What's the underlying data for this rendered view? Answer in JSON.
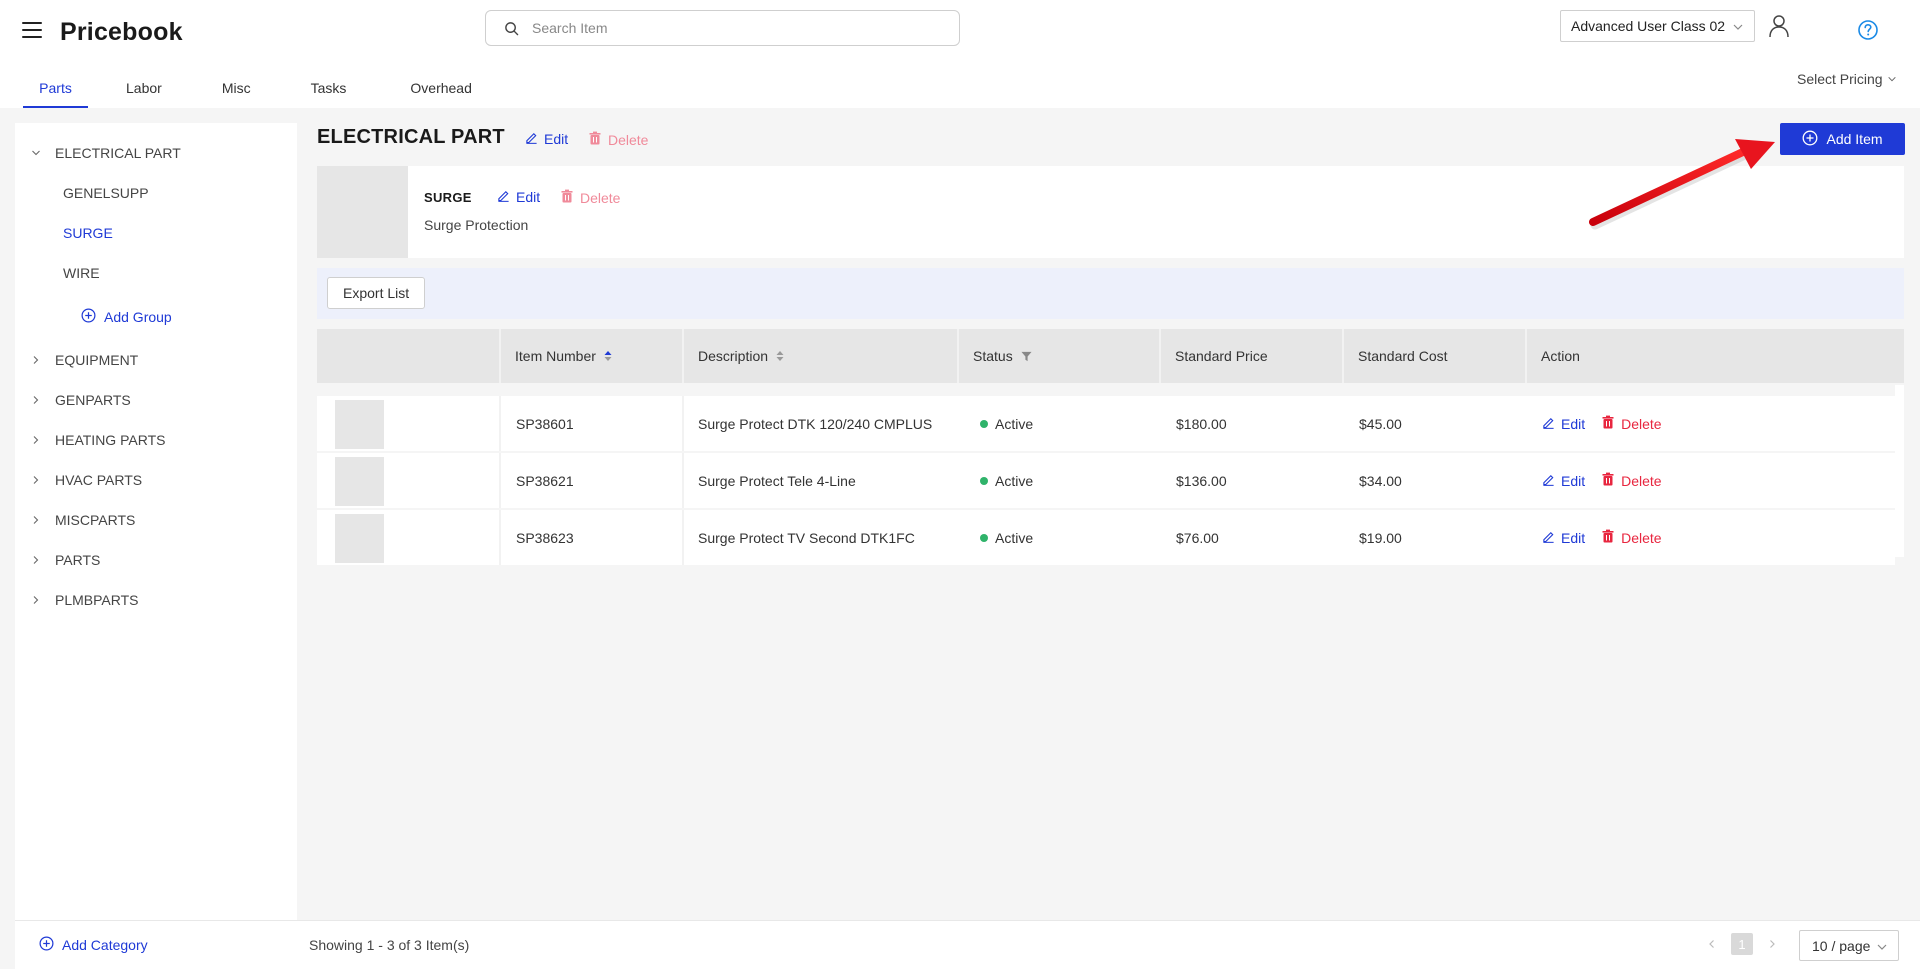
{
  "header": {
    "title": "Pricebook",
    "search_placeholder": "Search Item",
    "role_select": "Advanced User Class 02",
    "select_pricing": "Select Pricing"
  },
  "tabs": [
    {
      "label": "Parts",
      "active": true
    },
    {
      "label": "Labor"
    },
    {
      "label": "Misc"
    },
    {
      "label": "Tasks"
    },
    {
      "label": "Overhead"
    }
  ],
  "sidebar": {
    "categories": [
      {
        "label": "ELECTRICAL PART",
        "expanded": true
      },
      {
        "label": "EQUIPMENT"
      },
      {
        "label": "GENPARTS"
      },
      {
        "label": "HEATING PARTS"
      },
      {
        "label": "HVAC PARTS"
      },
      {
        "label": "MISCPARTS"
      },
      {
        "label": "PARTS"
      },
      {
        "label": "PLMBPARTS"
      }
    ],
    "groups": [
      {
        "label": "GENELSUPP"
      },
      {
        "label": "SURGE",
        "selected": true
      },
      {
        "label": "WIRE"
      }
    ],
    "add_group": "Add Group",
    "add_category": "Add Category"
  },
  "category": {
    "title": "ELECTRICAL PART",
    "edit": "Edit",
    "delete": "Delete",
    "add_item": "Add Item"
  },
  "group": {
    "name": "SURGE",
    "description": "Surge Protection",
    "edit": "Edit",
    "delete": "Delete"
  },
  "toolbar": {
    "export": "Export List"
  },
  "table": {
    "columns": [
      "Item Number",
      "Description",
      "Status",
      "Standard Price",
      "Standard Cost",
      "Action"
    ],
    "rows": [
      {
        "item": "SP38601",
        "description": "Surge Protect DTK 120/240 CMPLUS",
        "status": "Active",
        "price": "$180.00",
        "cost": "$45.00",
        "edit": "Edit",
        "delete": "Delete"
      },
      {
        "item": "SP38621",
        "description": "Surge Protect Tele 4-Line",
        "status": "Active",
        "price": "$136.00",
        "cost": "$34.00",
        "edit": "Edit",
        "delete": "Delete"
      },
      {
        "item": "SP38623",
        "description": "Surge Protect TV Second DTK1FC",
        "status": "Active",
        "price": "$76.00",
        "cost": "$19.00",
        "edit": "Edit",
        "delete": "Delete"
      }
    ]
  },
  "footer": {
    "showing": "Showing 1 - 3 of 3 Item(s)",
    "current_page": "1",
    "page_size": "10 / page"
  },
  "colors": {
    "primary": "#1f3ad6",
    "danger": "#e8263f",
    "danger_light": "#f08a9a",
    "status_active": "#2fb36a",
    "annotation_arrow": "#e8141e"
  }
}
